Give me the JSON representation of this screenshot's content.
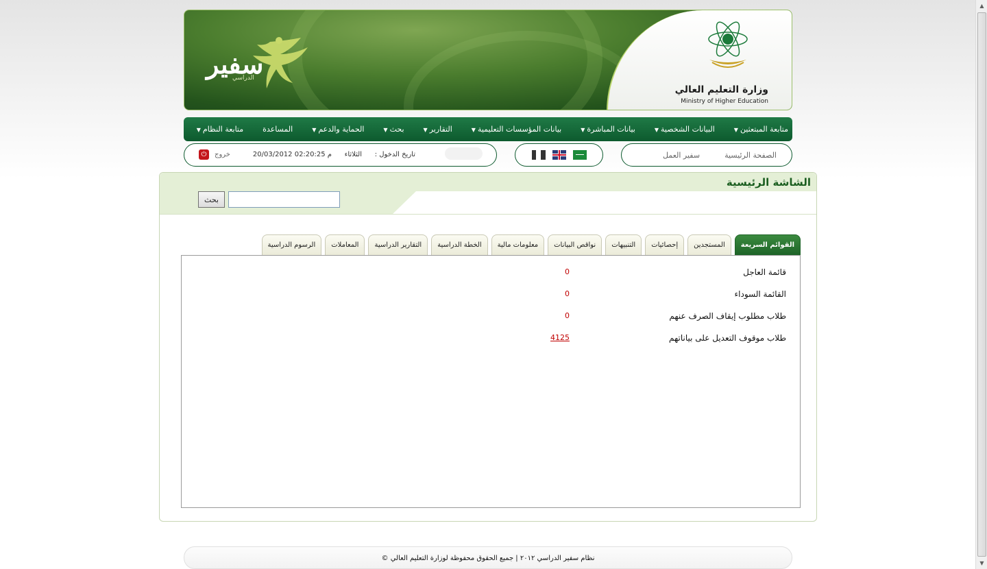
{
  "header": {
    "brand_name": "سفير",
    "brand_sub": "الدراسي",
    "ministry_ar": "وزارة التعليم العالي",
    "ministry_en": "Ministry of Higher Education"
  },
  "main_nav": {
    "items": [
      {
        "label": "متابعة المبتعثين",
        "dropdown": true
      },
      {
        "label": "البيانات الشخصية",
        "dropdown": true
      },
      {
        "label": "بيانات المباشرة",
        "dropdown": true
      },
      {
        "label": "بيانات المؤسسات التعليمية",
        "dropdown": true
      },
      {
        "label": "التقارير",
        "dropdown": true
      },
      {
        "label": "بحث",
        "dropdown": true
      },
      {
        "label": "الحماية والدعم",
        "dropdown": true
      },
      {
        "label": "المساعدة",
        "dropdown": false
      },
      {
        "label": "متابعة النظام",
        "dropdown": true
      }
    ]
  },
  "quick_links": {
    "home": "الصفحة الرئيسية",
    "work_ambassador": "سفير العمل"
  },
  "session": {
    "login_label": "تاريخ الدخول :",
    "login_day": "الثلاثاء",
    "login_datetime": "20/03/2012 02:20:25 م",
    "logout_label": "خروج"
  },
  "page": {
    "title": "الشاشة الرئيسية",
    "search_button": "بحث",
    "search_value": ""
  },
  "tabs": [
    {
      "label": "القوائم السريعة",
      "active": true
    },
    {
      "label": "المستجدين",
      "active": false
    },
    {
      "label": "إحصائيات",
      "active": false
    },
    {
      "label": "التنبيهات",
      "active": false
    },
    {
      "label": "نواقص البيانات",
      "active": false
    },
    {
      "label": "معلومات مالية",
      "active": false
    },
    {
      "label": "الخطة الدراسية",
      "active": false
    },
    {
      "label": "التقارير الدراسية",
      "active": false
    },
    {
      "label": "المعاملات",
      "active": false
    },
    {
      "label": "الرسوم الدراسية",
      "active": false
    }
  ],
  "quick_lists": [
    {
      "label": "قائمة العاجل",
      "value": "0",
      "link": false
    },
    {
      "label": "القائمة السوداء",
      "value": "0",
      "link": false
    },
    {
      "label": "طلاب مطلوب إيقاف الصرف عنهم",
      "value": "0",
      "link": false
    },
    {
      "label": "طلاب موقوف التعديل على بياناتهم",
      "value": "4125",
      "link": true
    }
  ],
  "footer": {
    "text": "نظام سفير الدراسي ٢٠١٢ | جميع الحقوق محفوظة لوزارة التعليم العالي ©"
  },
  "colors": {
    "nav_green": "#0d5a2e",
    "value_red": "#c00000",
    "title_green": "#1b5e20",
    "tab_active": "#2f7a35"
  },
  "icons": [
    "power-icon",
    "flag-sa-icon",
    "flag-uk-icon",
    "flag-fr-icon",
    "caret-down-icon"
  ]
}
